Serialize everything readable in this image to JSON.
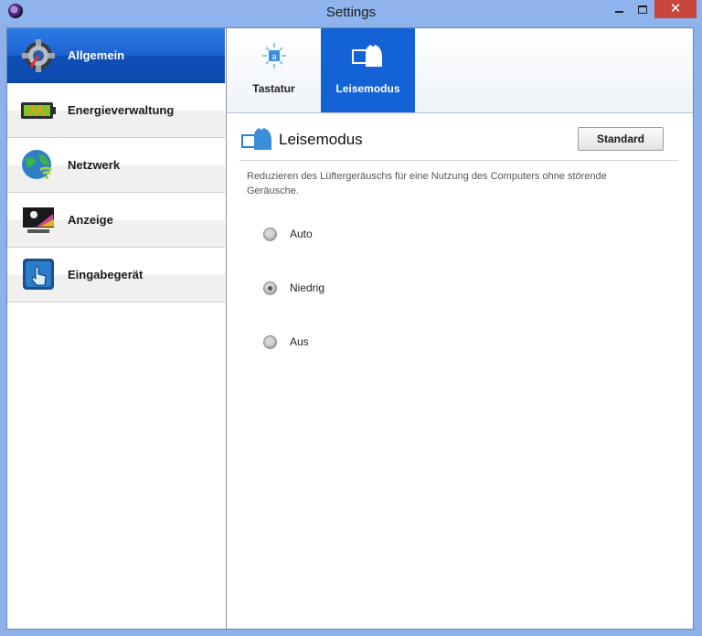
{
  "window": {
    "title": "Settings",
    "close_glyph": "✕"
  },
  "sidebar": {
    "items": [
      {
        "label": "Allgemein",
        "icon": "gear-icon",
        "active": true
      },
      {
        "label": "Energieverwaltung",
        "icon": "battery-icon",
        "active": false
      },
      {
        "label": "Netzwerk",
        "icon": "globe-wifi-icon",
        "active": false
      },
      {
        "label": "Anzeige",
        "icon": "display-icon",
        "active": false
      },
      {
        "label": "Eingabegerät",
        "icon": "touch-icon",
        "active": false
      }
    ]
  },
  "tabs": [
    {
      "label": "Tastatur",
      "icon": "keyboard-backlight-icon",
      "active": false
    },
    {
      "label": "Leisemodus",
      "icon": "silent-mode-icon",
      "active": true
    }
  ],
  "section": {
    "title": "Leisemodus",
    "default_button": "Standard",
    "description": "Reduzieren des Lüftergeräuschs für eine Nutzung des Computers ohne störende Geräusche."
  },
  "fan_options": [
    {
      "label": "Auto",
      "checked": false
    },
    {
      "label": "Niedrig",
      "checked": true
    },
    {
      "label": "Aus",
      "checked": false
    }
  ],
  "colors": {
    "accent": "#1463d6",
    "titlebar": "#8fb3ec",
    "close": "#c7453a"
  }
}
